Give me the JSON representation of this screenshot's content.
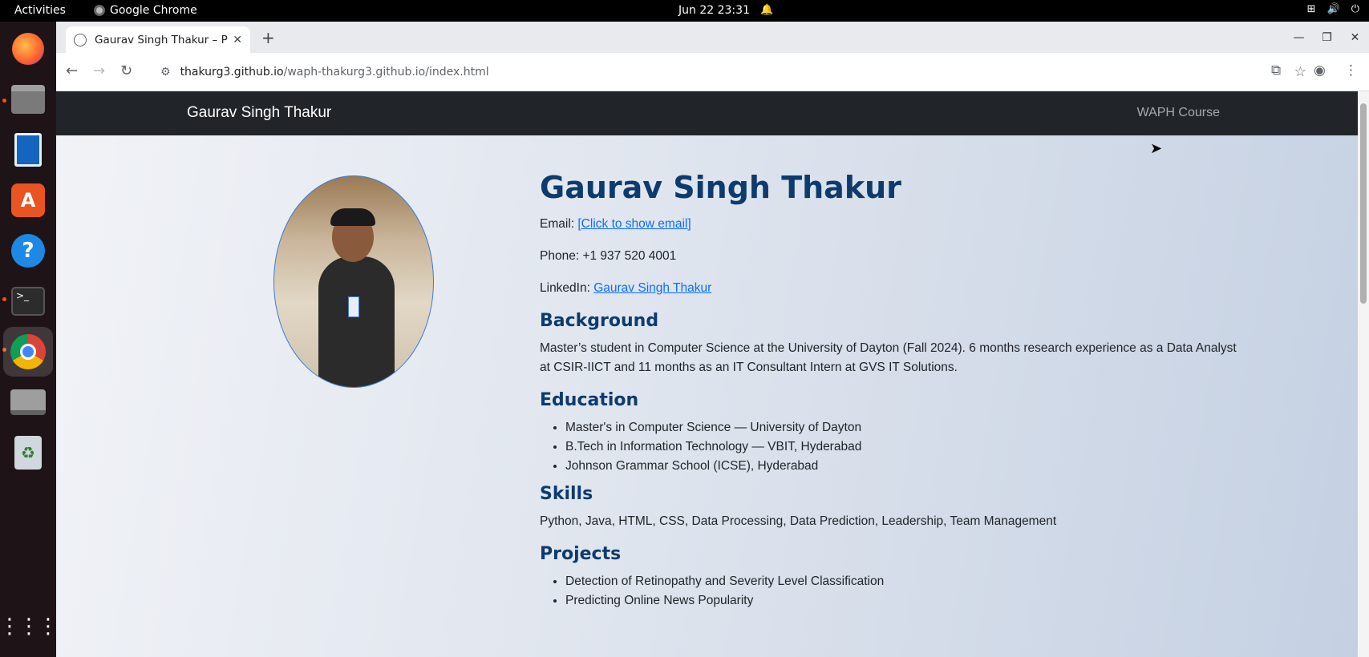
{
  "system": {
    "activities": "Activities",
    "app_name": "Google Chrome",
    "clock": "Jun 22  23:31"
  },
  "browser": {
    "tab_title": "Gaurav Singh Thakur – Pr",
    "url_host": "thakurg3.github.io",
    "url_path": "/waph-thakurg3.github.io/index.html"
  },
  "page": {
    "navbar": {
      "brand": "Gaurav Singh Thakur",
      "link": "WAPH Course"
    },
    "name": "Gaurav Singh Thakur",
    "email_label": "Email: ",
    "email_link": "[Click to show email]",
    "phone_label": "Phone: ",
    "phone": "+1 937 520 4001",
    "linkedin_label": "LinkedIn: ",
    "linkedin_link": "Gaurav Singh Thakur",
    "background": {
      "heading": "Background",
      "text": "Master’s student in Computer Science at the University of Dayton (Fall 2024). 6 months research experience as a Data Analyst at CSIR-IICT and 11 months as an IT Consultant Intern at GVS IT Solutions."
    },
    "education": {
      "heading": "Education",
      "items": [
        "Master's in Computer Science — University of Dayton",
        "B.Tech in Information Technology — VBIT, Hyderabad",
        "Johnson Grammar School (ICSE), Hyderabad"
      ]
    },
    "skills": {
      "heading": "Skills",
      "text": "Python, Java, HTML, CSS, Data Processing, Data Prediction, Leadership, Team Management"
    },
    "projects": {
      "heading": "Projects",
      "items": [
        "Detection of Retinopathy and Severity Level Classification",
        "Predicting Online News Popularity"
      ]
    }
  },
  "colors": {
    "heading": "#0d3b6e",
    "link": "#0d6efd",
    "navbar": "#212529"
  }
}
